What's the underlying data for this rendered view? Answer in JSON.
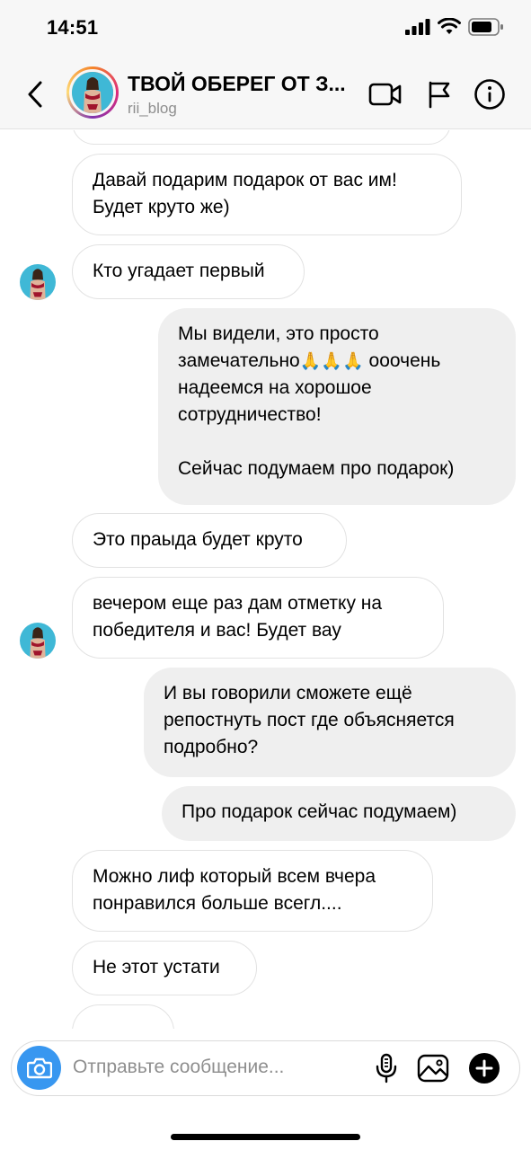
{
  "status": {
    "time": "14:51"
  },
  "header": {
    "title": "ТВОЙ ОБЕРЕГ ОТ З...",
    "username": "rii_blog"
  },
  "messages": [
    {
      "side": "in",
      "text": "Давай подарим подарок от вас им!\nБудет круто же)"
    },
    {
      "side": "in",
      "text": "Кто угадает первый"
    },
    {
      "side": "out",
      "text": "Мы видели, это просто замечательно🙏🏻🙏🏻🙏🏻 ооочень надеемся на хорошое сотрудничество!\n\nСейчас подумаем про подарок)"
    },
    {
      "side": "in",
      "text": "Это праыда будет круто"
    },
    {
      "side": "in",
      "text": "вечером еще раз дам отметку на победителя и вас! Будет вау"
    },
    {
      "side": "out",
      "text": "И вы говорили сможете ещё репостнуть пост где объясняется подробно?"
    },
    {
      "side": "out",
      "text": "Про подарок сейчас подумаем)"
    },
    {
      "side": "in",
      "text": "Можно лиф который всем вчера понравился больше всегл...."
    },
    {
      "side": "in",
      "text": "Не этот устати"
    }
  ],
  "composer": {
    "placeholder": "Отправьте сообщение..."
  },
  "icons": {
    "back": "chevron-left-icon",
    "video": "video-call-icon",
    "flag": "flag-icon",
    "info": "info-icon",
    "camera": "camera-icon",
    "mic": "microphone-icon",
    "gallery": "gallery-icon",
    "plus": "plus-circle-icon"
  },
  "colors": {
    "accent": "#3897f0",
    "incoming_border": "#e2e2e2",
    "outgoing_bg": "#efefef"
  }
}
